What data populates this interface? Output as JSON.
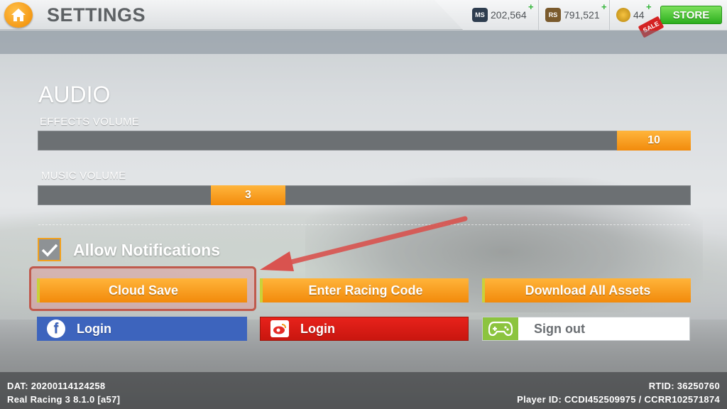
{
  "header": {
    "title": "SETTINGS",
    "currencies": [
      {
        "code": "MS",
        "amount": "202,564"
      },
      {
        "code": "RS",
        "amount": "791,521"
      },
      {
        "code": "gold",
        "amount": "44"
      }
    ],
    "store_label": "STORE",
    "sale_label": "SALE"
  },
  "audio": {
    "title": "AUDIO",
    "effects": {
      "label": "EFFECTS VOLUME",
      "value": "10"
    },
    "music": {
      "label": "MUSIC  VOLUME",
      "value": "3"
    }
  },
  "notifications": {
    "label": "Allow Notifications",
    "checked": true
  },
  "buttons": {
    "cloud_save": "Cloud Save",
    "enter_code": "Enter Racing Code",
    "download_assets": "Download All Assets",
    "facebook_login": "Login",
    "weibo_login": "Login",
    "sign_out": "Sign out"
  },
  "footer": {
    "dat": "DAT: 20200114124258",
    "version": "Real Racing 3 8.1.0 [a57]",
    "rtid": "RTID:  36250760",
    "player_id": "Player ID: CCDI452509975 / CCRR102571874"
  },
  "colors": {
    "accent_orange": "#f28a0b",
    "store_green": "#2cae1e",
    "facebook_blue": "#3d64bd",
    "weibo_red": "#d81c15",
    "annotation_red": "#d9534f"
  }
}
